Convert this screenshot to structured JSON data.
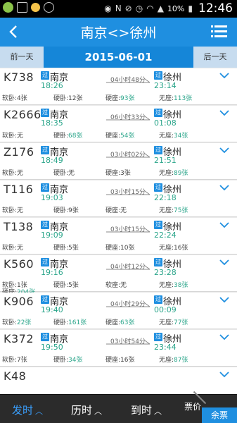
{
  "status": {
    "battery": "10%",
    "time": "12:46"
  },
  "header": {
    "title": "南京<>徐州"
  },
  "datebar": {
    "prev": "前一天",
    "date": "2015-06-01",
    "next": "后一天"
  },
  "pass_badge": "过",
  "trains": [
    {
      "code": "K738",
      "from": "南京",
      "dep": "18:26",
      "duration": "04小时48分",
      "to": "徐州",
      "arr": "23:14",
      "seats": [
        {
          "label": "软卧:",
          "val": "4张",
          "avail": false
        },
        {
          "label": "硬卧:",
          "val": "12张",
          "avail": false
        },
        {
          "label": "硬座:",
          "val": "93张",
          "avail": true
        },
        {
          "label": "无座:",
          "val": "113张",
          "avail": true
        }
      ]
    },
    {
      "code": "K2666",
      "from": "南京",
      "dep": "18:35",
      "duration": "06小时33分",
      "to": "徐州",
      "arr": "01:08",
      "seats": [
        {
          "label": "软卧:",
          "val": "无",
          "avail": false
        },
        {
          "label": "硬卧:",
          "val": "68张",
          "avail": true
        },
        {
          "label": "硬座:",
          "val": "54张",
          "avail": true
        },
        {
          "label": "无座:",
          "val": "34张",
          "avail": true
        }
      ]
    },
    {
      "code": "Z176",
      "from": "南京",
      "dep": "18:49",
      "duration": "03小时02分",
      "to": "徐州",
      "arr": "21:51",
      "seats": [
        {
          "label": "软卧:",
          "val": "无",
          "avail": false
        },
        {
          "label": "硬卧:",
          "val": "无",
          "avail": false
        },
        {
          "label": "硬座:",
          "val": "3张",
          "avail": false
        },
        {
          "label": "无座:",
          "val": "89张",
          "avail": true
        }
      ]
    },
    {
      "code": "T116",
      "from": "南京",
      "dep": "19:03",
      "duration": "03小时15分",
      "to": "徐州",
      "arr": "22:18",
      "seats": [
        {
          "label": "软卧:",
          "val": "无",
          "avail": false
        },
        {
          "label": "硬卧:",
          "val": "9张",
          "avail": false
        },
        {
          "label": "硬座:",
          "val": "无",
          "avail": false
        },
        {
          "label": "无座:",
          "val": "75张",
          "avail": true
        }
      ]
    },
    {
      "code": "T138",
      "from": "南京",
      "dep": "19:09",
      "duration": "03小时15分",
      "to": "徐州",
      "arr": "22:24",
      "seats": [
        {
          "label": "软卧:",
          "val": "无",
          "avail": false
        },
        {
          "label": "硬卧:",
          "val": "5张",
          "avail": false
        },
        {
          "label": "硬座:",
          "val": "10张",
          "avail": false
        },
        {
          "label": "无座:",
          "val": "16张",
          "avail": false
        }
      ]
    },
    {
      "code": "K560",
      "from": "南京",
      "dep": "19:16",
      "duration": "04小时12分",
      "to": "徐州",
      "arr": "23:28",
      "seats": [
        {
          "label": "软卧:",
          "val": "1张",
          "avail": false
        },
        {
          "label": "硬卧:",
          "val": "5张",
          "avail": false
        },
        {
          "label": "软座:",
          "val": "无",
          "avail": false
        },
        {
          "label": "无座:",
          "val": "38张",
          "avail": true
        },
        {
          "label": "硬座:",
          "val": "204张",
          "avail": true
        }
      ]
    },
    {
      "code": "K906",
      "from": "南京",
      "dep": "19:40",
      "duration": "04小时29分",
      "to": "徐州",
      "arr": "00:09",
      "seats": [
        {
          "label": "软卧:",
          "val": "22张",
          "avail": true
        },
        {
          "label": "硬卧:",
          "val": "161张",
          "avail": true
        },
        {
          "label": "硬座:",
          "val": "63张",
          "avail": true
        },
        {
          "label": "无座:",
          "val": "77张",
          "avail": true
        }
      ]
    },
    {
      "code": "K372",
      "from": "南京",
      "dep": "19:50",
      "duration": "03小时54分",
      "to": "徐州",
      "arr": "23:44",
      "seats": [
        {
          "label": "软卧:",
          "val": "7张",
          "avail": false
        },
        {
          "label": "硬卧:",
          "val": "34张",
          "avail": true
        },
        {
          "label": "硬座:",
          "val": "16张",
          "avail": false
        },
        {
          "label": "无座:",
          "val": "87张",
          "avail": true
        }
      ]
    },
    {
      "code": "K48",
      "from": "",
      "dep": "",
      "duration": "",
      "to": "",
      "arr": "",
      "seats": []
    }
  ],
  "bottombar": {
    "depart": "发时",
    "duration": "历时",
    "arrive": "到时",
    "price": "票价",
    "ticket": "余票"
  },
  "colors": {
    "primary": "#1f8fe0",
    "available": "#2aa58a",
    "datebar_button": "#c7dcef"
  }
}
